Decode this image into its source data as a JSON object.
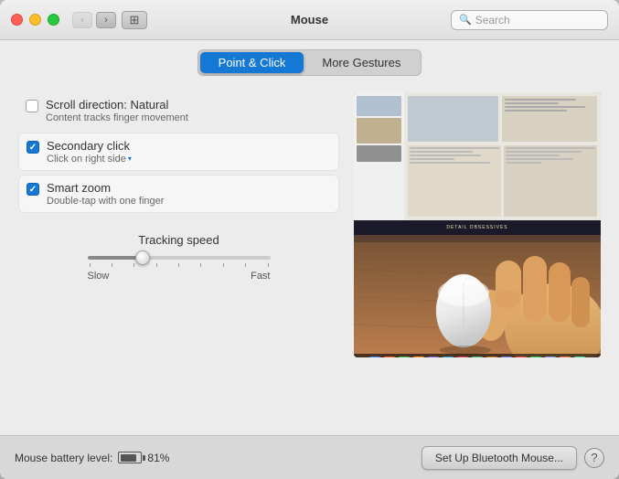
{
  "window": {
    "title": "Mouse"
  },
  "search": {
    "placeholder": "Search"
  },
  "tabs": [
    {
      "id": "point-click",
      "label": "Point & Click",
      "active": true
    },
    {
      "id": "more-gestures",
      "label": "More Gestures",
      "active": false
    }
  ],
  "options": [
    {
      "id": "scroll-direction",
      "title": "Scroll direction: Natural",
      "subtitle": "Content tracks finger movement",
      "checked": false
    },
    {
      "id": "secondary-click",
      "title": "Secondary click",
      "subtitle": "Click on right side",
      "has_dropdown": true,
      "checked": true
    },
    {
      "id": "smart-zoom",
      "title": "Smart zoom",
      "subtitle": "Double-tap with one finger",
      "checked": true
    }
  ],
  "tracking": {
    "label": "Tracking speed",
    "slow_label": "Slow",
    "fast_label": "Fast"
  },
  "bottom": {
    "battery_label": "Mouse battery level:",
    "battery_percent": "81%",
    "bluetooth_btn": "Set Up Bluetooth Mouse...",
    "help_icon": "?"
  },
  "preview": {
    "banner_text": "DETAIL OBSESSIVES"
  },
  "dock_colors": [
    "#4080ff",
    "#ff6030",
    "#30c050",
    "#ffa020",
    "#8060e0",
    "#20a0d0",
    "#e04060",
    "#40c080",
    "#d08020",
    "#6080ff",
    "#ff4040",
    "#20d060",
    "#80a0ff",
    "#ff8040",
    "#40e0b0"
  ]
}
